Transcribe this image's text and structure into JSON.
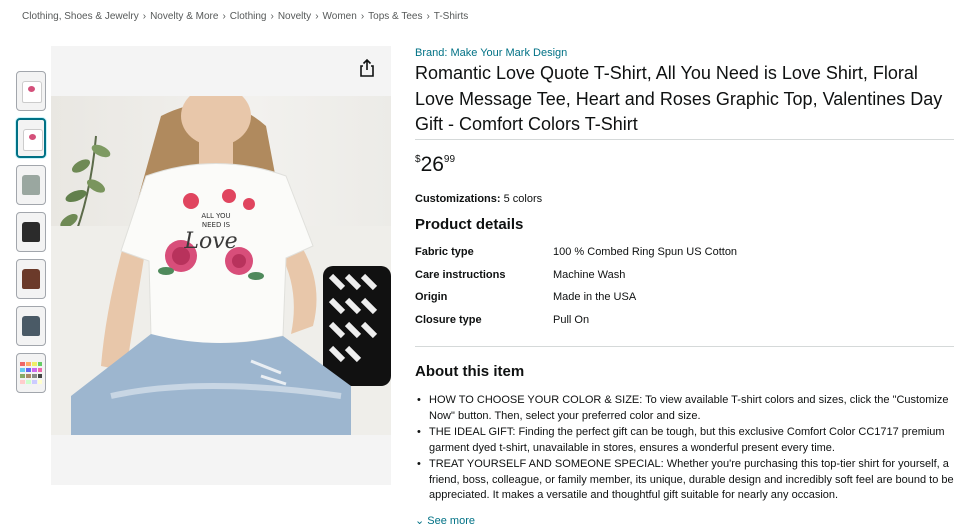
{
  "breadcrumb": [
    "Clothing, Shoes & Jewelry",
    "Novelty & More",
    "Clothing",
    "Novelty",
    "Women",
    "Tops & Tees",
    "T-Shirts"
  ],
  "breadcrumb_separator": "›",
  "brand": "Brand: Make Your Mark Design",
  "title": "Romantic Love Quote T-Shirt, All You Need is Love Shirt, Floral Love Message Tee, Heart and Roses Graphic Top, Valentines Day Gift - Comfort Colors T-Shirt",
  "price": {
    "currency": "$",
    "whole": "26",
    "fraction": "99"
  },
  "customizations": {
    "label": "Customizations:",
    "value": "5 colors"
  },
  "product_details": {
    "heading": "Product details",
    "rows": [
      {
        "key": "Fabric type",
        "value": "100 % Combed Ring Spun US Cotton"
      },
      {
        "key": "Care instructions",
        "value": "Machine Wash"
      },
      {
        "key": "Origin",
        "value": "Made in the USA"
      },
      {
        "key": "Closure type",
        "value": "Pull On"
      }
    ]
  },
  "about": {
    "heading": "About this item",
    "bullets": [
      "HOW TO CHOOSE YOUR COLOR & SIZE: To view available T-shirt colors and sizes, click the \"Customize Now\" button. Then, select your preferred color and size.",
      "THE IDEAL GIFT: Finding the perfect gift can be tough, but this exclusive Comfort Color CC1717 premium garment dyed t-shirt, unavailable in stores, ensures a wonderful present every time.",
      "TREAT YOURSELF AND SOMEONE SPECIAL: Whether you're purchasing this top-tier shirt for yourself, a friend, boss, colleague, or family member, its unique, durable design and incredibly soft feel are bound to be appreciated. It makes a versatile and thoughtful gift suitable for nearly any occasion."
    ],
    "see_more": "See more"
  },
  "image": {
    "graphic_text": [
      "ALL YOU",
      "NEED IS",
      "Love"
    ]
  },
  "thumbnails": [
    {
      "icon": "shirt-photo-thumbnail",
      "color": "#ffffff"
    },
    {
      "icon": "shirt-photo-thumbnail",
      "color": "#ffffff"
    },
    {
      "icon": "shirt-photo-thumbnail",
      "color": "#9aa7a0"
    },
    {
      "icon": "shirt-photo-thumbnail",
      "color": "#2b2b2b"
    },
    {
      "icon": "shirt-photo-thumbnail",
      "color": "#6b3a2a"
    },
    {
      "icon": "shirt-photo-thumbnail",
      "color": "#4a5a66"
    },
    {
      "icon": "color-chart-thumbnail",
      "color": "#cfcfcf"
    }
  ],
  "colors": {
    "link": "#007185",
    "text": "#0F1111",
    "muted": "#565959",
    "divider": "#d5d9d9"
  }
}
